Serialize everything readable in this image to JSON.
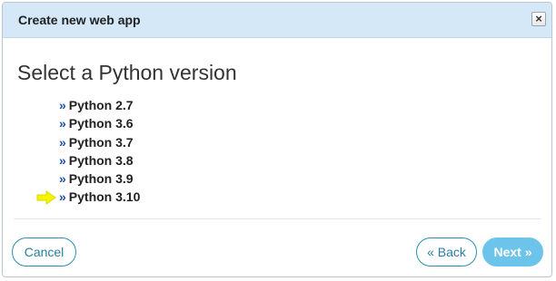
{
  "dialog": {
    "title": "Create new web app",
    "close_label": "×"
  },
  "main": {
    "heading": "Select a Python version",
    "bullet": "»",
    "versions": [
      {
        "label": "Python 2.7"
      },
      {
        "label": "Python 3.6"
      },
      {
        "label": "Python 3.7"
      },
      {
        "label": "Python 3.8"
      },
      {
        "label": "Python 3.9"
      },
      {
        "label": "Python 3.10",
        "highlighted": true
      }
    ],
    "highlight_icon": "right-arrow-icon",
    "highlight_color": "#f5f500"
  },
  "footer": {
    "cancel_label": "Cancel",
    "back_label": "« Back",
    "next_label": "Next »"
  },
  "colors": {
    "titlebar_bg": "#d4e8f8",
    "accent": "#2a8fb0",
    "primary_button": "#6cc4ea"
  }
}
